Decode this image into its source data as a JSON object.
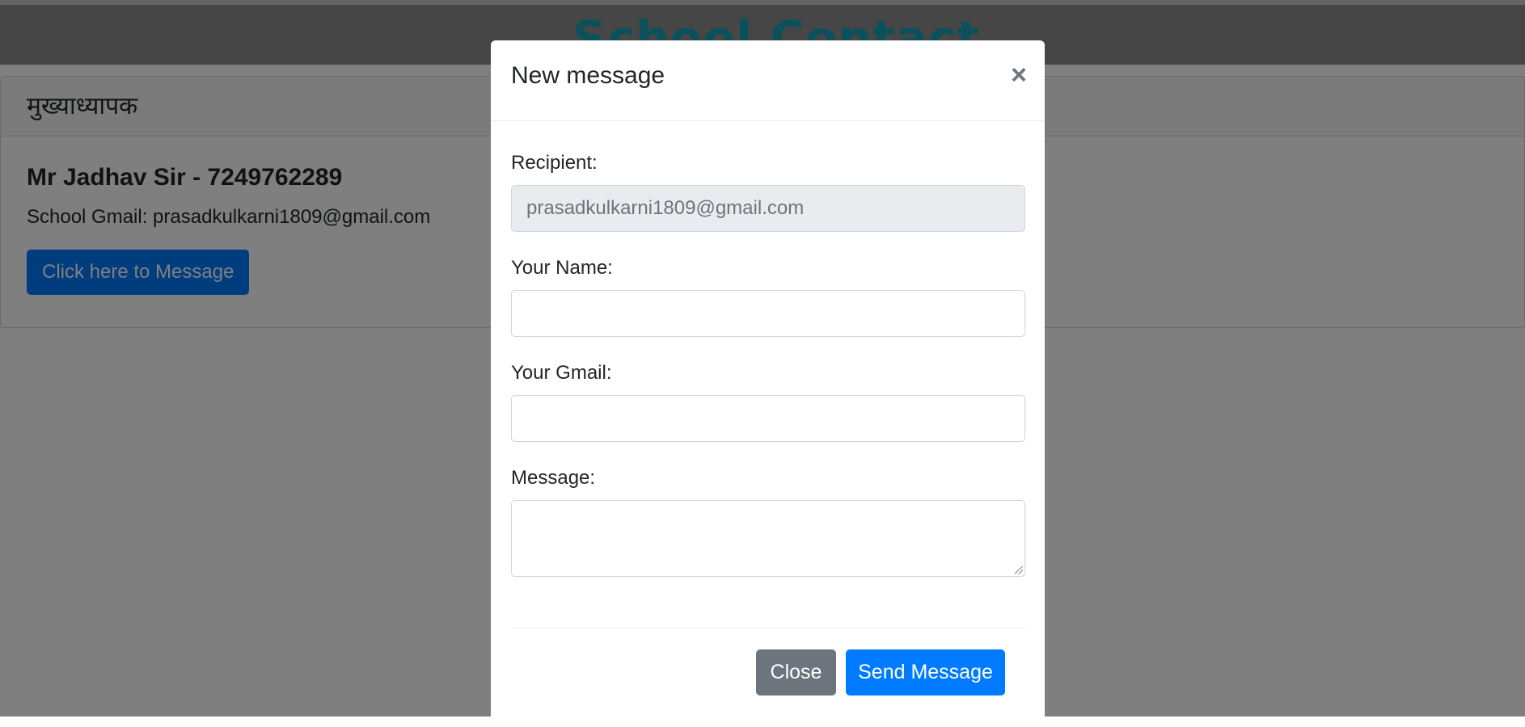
{
  "site": {
    "title": "School Contact"
  },
  "card": {
    "header": "मुख्याध्यापक",
    "contact_name": "Mr Jadhav Sir - 7249762289",
    "gmail_line": "School Gmail: prasadkulkarni1809@gmail.com",
    "message_button": "Click here to Message"
  },
  "modal": {
    "title": "New message",
    "close_icon": "×",
    "fields": {
      "recipient_label": "Recipient:",
      "recipient_value": "prasadkulkarni1809@gmail.com",
      "name_label": "Your Name:",
      "name_value": "",
      "gmail_label": "Your Gmail:",
      "gmail_value": "",
      "message_label": "Message:",
      "message_value": ""
    },
    "buttons": {
      "close": "Close",
      "send": "Send Message"
    }
  },
  "colors": {
    "title_teal": "#17a2b8",
    "primary": "#007bff",
    "secondary": "#6c757d"
  }
}
